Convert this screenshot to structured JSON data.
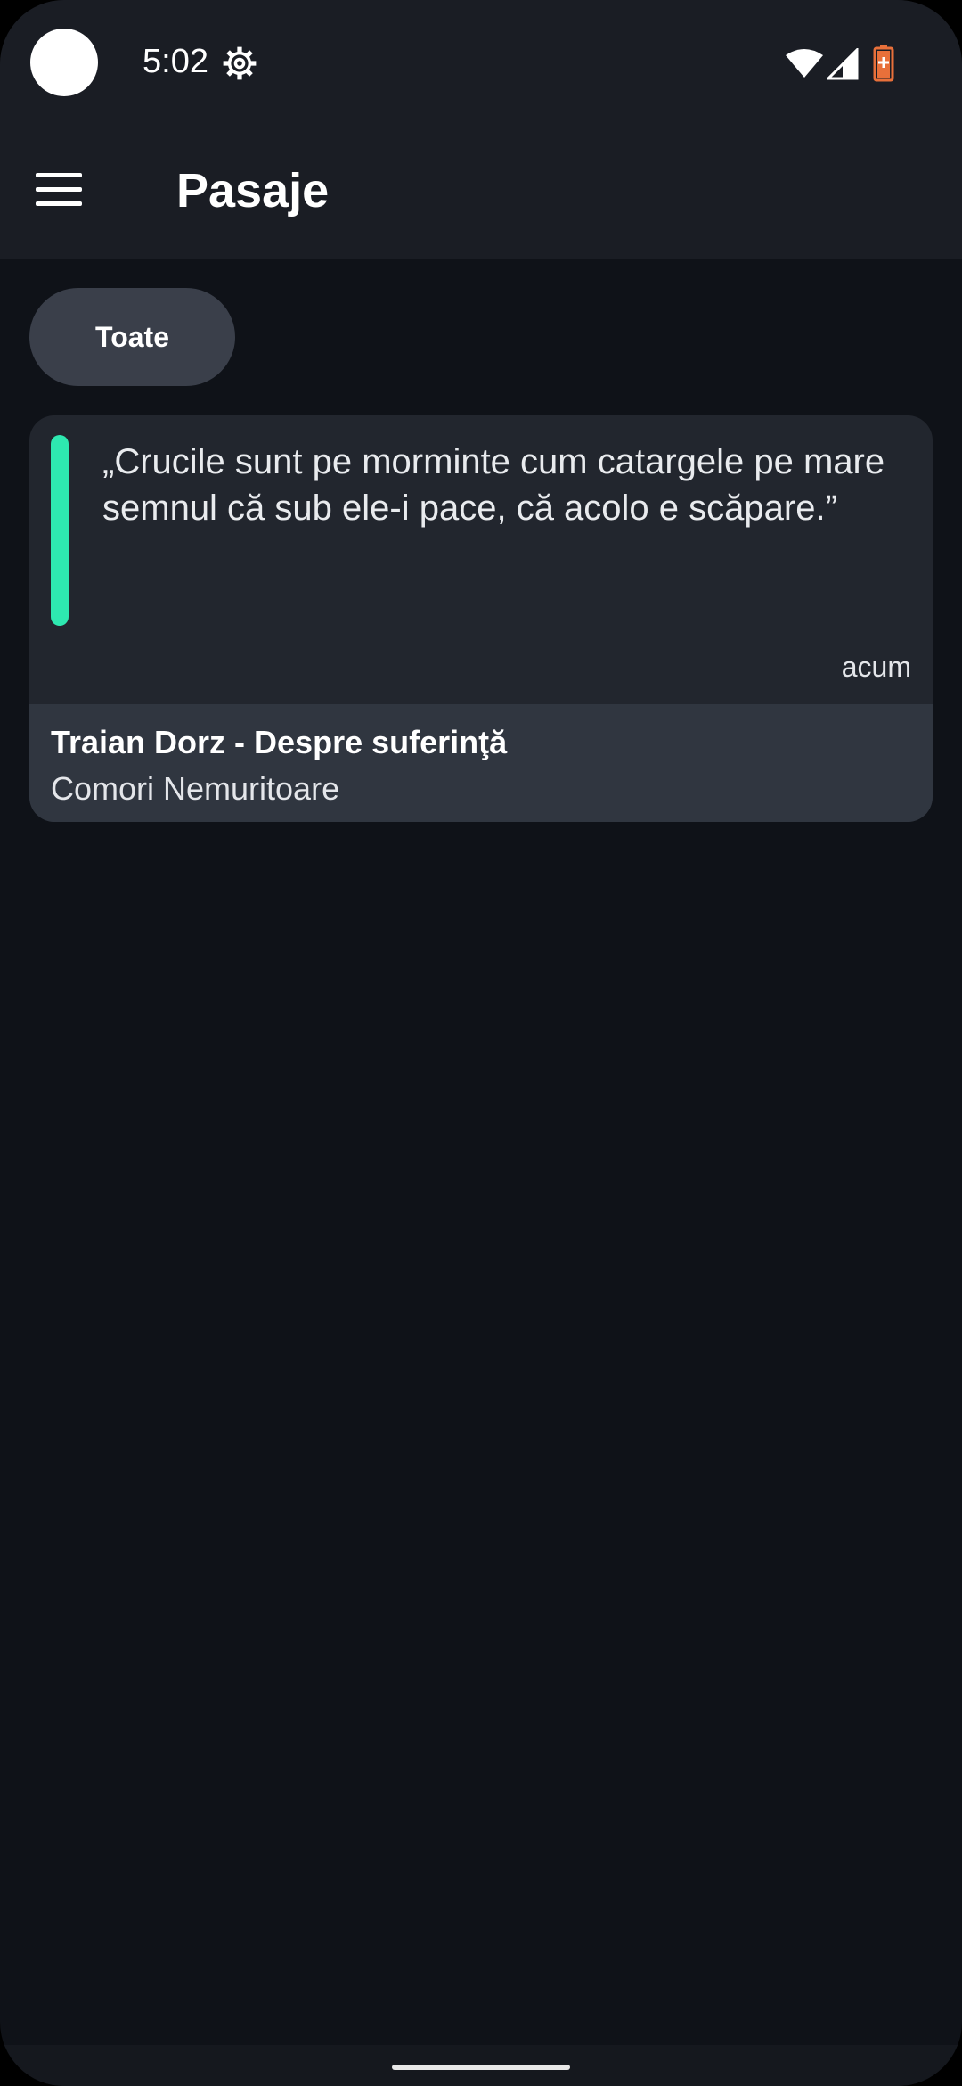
{
  "status_bar": {
    "time": "5:02",
    "icons": [
      "settings-icon",
      "wifi-icon",
      "signal-icon",
      "battery-icon"
    ],
    "battery_color": "#e8703a"
  },
  "app_bar": {
    "title": "Pasaje",
    "menu_icon": "hamburger-menu-icon"
  },
  "filters": {
    "chips": [
      "Toate"
    ]
  },
  "passages": [
    {
      "quote": "„Crucile sunt pe morminte cum catargele pe mare\nsemnul că sub ele-i pace, că acolo e scăpare.”",
      "time": "acum",
      "author": "Traian Dorz - Despre suferinţă",
      "source": "Comori Nemuritoare",
      "accent_color": "#2ee8b0"
    }
  ],
  "colors": {
    "background": "#0f1218",
    "bar": "#1a1d24",
    "card": "#22262e",
    "card_footer": "#303640",
    "chip": "#3a3f4a"
  }
}
